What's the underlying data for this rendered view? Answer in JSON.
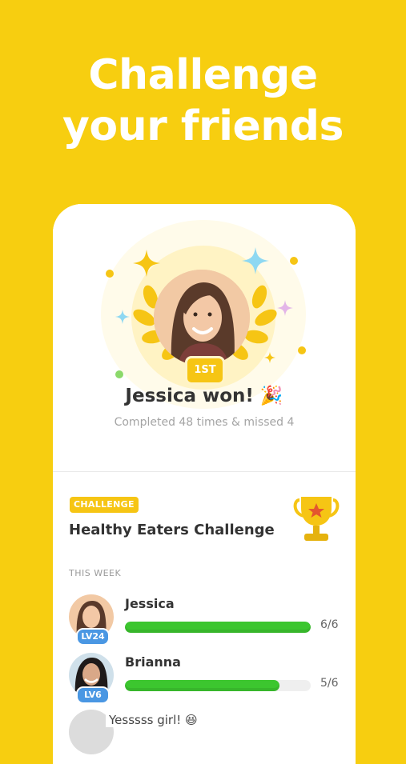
{
  "headline": {
    "line1": "Challenge",
    "line2": "your friends"
  },
  "winner": {
    "rank": "1ST",
    "title": "Jessica won! 🎉",
    "subtitle": "Completed 48 times & missed 4"
  },
  "challenge": {
    "tag": "CHALLENGE",
    "title": "Healthy Eaters Challenge",
    "period": "THIS WEEK"
  },
  "participants": [
    {
      "name": "Jessica",
      "level": "LV24",
      "progress": "6/6",
      "fraction": 1.0
    },
    {
      "name": "Brianna",
      "level": "LV6",
      "progress": "5/6",
      "fraction": 0.8333
    }
  ],
  "peek_text": "Yesssss girl! 😆",
  "colors": {
    "background": "#F7CE10",
    "accent": "#F6C514",
    "progress": "#3CC62F",
    "level_badge": "#4A97E3"
  }
}
